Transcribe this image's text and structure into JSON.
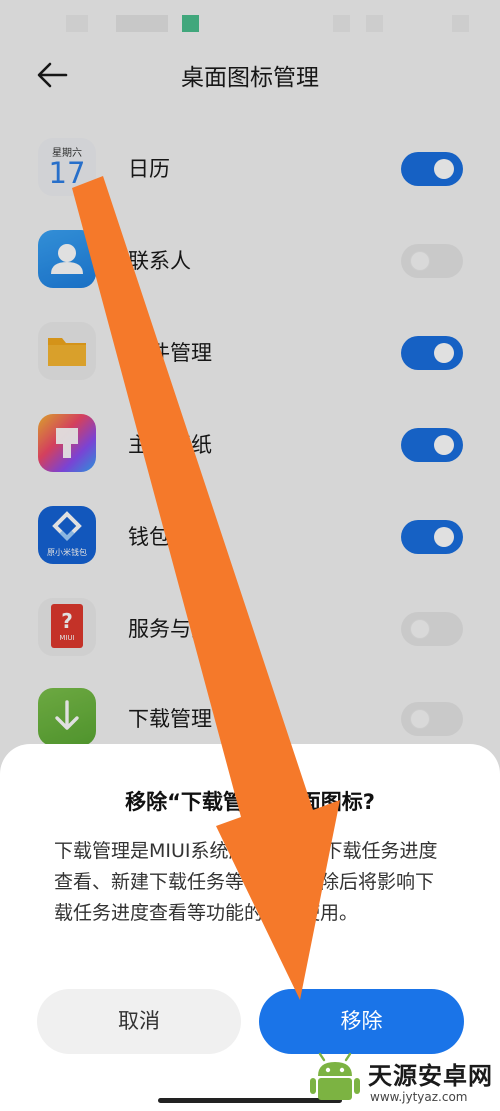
{
  "header": {
    "title": "桌面图标管理"
  },
  "apps": [
    {
      "label": "日历",
      "enabled": true,
      "icon": "calendar-icon",
      "calendar_weekday": "星期六",
      "calendar_day": "17"
    },
    {
      "label": "联系人",
      "enabled": false,
      "icon": "contacts-icon"
    },
    {
      "label": "文件管理",
      "enabled": true,
      "icon": "folder-icon"
    },
    {
      "label": "主题壁纸",
      "enabled": true,
      "icon": "themes-brush-icon"
    },
    {
      "label": "钱包",
      "enabled": true,
      "icon": "wallet-icon",
      "icon_caption": "原小米钱包"
    },
    {
      "label": "服务与反馈",
      "enabled": false,
      "icon": "service-feedback-icon",
      "icon_caption": "MIUI"
    },
    {
      "label": "下载管理",
      "enabled": false,
      "icon": "download-icon"
    }
  ],
  "dialog": {
    "title": "移除“下载管理”桌面图标?",
    "message": "下载管理是MIUI系统应用，提供下载任务进度查看、新建下载任务等功能。移除后将影响下载任务进度查看等功能的正常使用。",
    "cancel_label": "取消",
    "confirm_label": "移除"
  },
  "watermark": {
    "title": "天源安卓网",
    "url": "www.jytyaz.com"
  },
  "colors": {
    "accent": "#1a74e8",
    "toggle_on": "#1a6fe0",
    "arrow": "#f5792a",
    "status_green": "#4bbf8e"
  }
}
